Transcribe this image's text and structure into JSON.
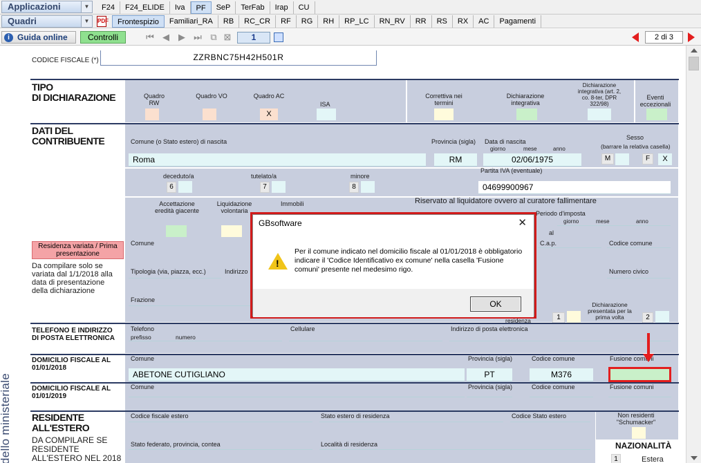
{
  "toolbar": {
    "applicazioni": "Applicazioni",
    "quadri": "Quadri",
    "tabs_top": [
      "F24",
      "F24_ELIDE",
      "Iva",
      "PF",
      "SeP",
      "TerFab",
      "Irap",
      "CU"
    ],
    "active_top": "PF",
    "tabs_second": [
      "Frontespizio",
      "Familiari_RA",
      "RB",
      "RC_CR",
      "RF",
      "RG",
      "RH",
      "RP_LC",
      "RN_RV",
      "RR",
      "RS",
      "RX",
      "AC",
      "Pagamenti"
    ],
    "active_second": "Frontespizio",
    "guida_online": "Guida online",
    "controlli": "Controlli",
    "page_number": "1",
    "page_count": "2 di 3"
  },
  "form": {
    "codice_fiscale_label": "CODICE FISCALE (*)",
    "codice_fiscale_value": "ZZRBNC75H42H501R",
    "tipo_title_1": "TIPO",
    "tipo_title_2": "DI DICHIARAZIONE",
    "quadro_rw": "Quadro RW",
    "quadro_vo": "Quadro VO",
    "quadro_ac": "Quadro AC",
    "quadro_ac_value": "X",
    "isa": "ISA",
    "correttiva": "Correttiva nei termini",
    "dich_integrativa": "Dichiarazione integrativa",
    "dich_integrativa_art": "Dichiarazione integrativa (art. 2, co. 8-ter, DPR 322/98)",
    "eventi": "Eventi eccezionali",
    "dati_title_1": "DATI DEL",
    "dati_title_2": "CONTRIBUENTE",
    "comune_nascita_label": "Comune (o Stato estero) di nascita",
    "comune_nascita_value": "Roma",
    "provincia_label": "Provincia (sigla)",
    "provincia_value": "RM",
    "data_nascita_label": "Data di nascita",
    "giorno": "giorno",
    "mese": "mese",
    "anno": "anno",
    "data_nascita_value": "02/06/1975",
    "sesso_label": "Sesso",
    "sesso_sub": "(barrare la relativa casella)",
    "sesso_m": "M",
    "sesso_f": "F",
    "sesso_value": "X",
    "deceduto": "deceduto/a",
    "deceduto_n": "6",
    "tutelato": "tutelato/a",
    "tutelato_n": "7",
    "minore": "minore",
    "minore_n": "8",
    "partita_iva_label": "Partita IVA (eventuale)",
    "partita_iva_value": "04699900967",
    "accettazione": "Accettazione eredità giacente",
    "liquidazione": "Liquidazione volontaria",
    "immobili": "Immobili",
    "riservato": "Riservato al liquidatore ovvero al curatore fallimentare",
    "periodo_imposta": "Periodo d'imposta",
    "al": "al",
    "residenza_variata": "Residenza variata / Prima presentazione",
    "da_compilare": "Da compilare solo se variata dal 1/1/2018 alla data di presentazione della dichiarazione",
    "comune": "Comune",
    "cap": "C.a.p.",
    "codice_comune": "Codice comune",
    "tipologia": "Tipologia (via, piazza, ecc.)",
    "indirizzo": "Indirizzo",
    "numero_civico": "Numero civico",
    "frazione": "Frazione",
    "residenza": "residenza",
    "dich_presentata": "Dichiarazione presentata per la prima volta",
    "dich_presentata_n": "2",
    "box_1": "1",
    "telefono_title": "TELEFONO E INDIRIZZO DI POSTA ELETTRONICA",
    "telefono": "Telefono",
    "prefisso": "prefisso",
    "numero": "numero",
    "cellulare": "Cellulare",
    "email": "Indirizzo di posta elettronica",
    "dom2018_title": "DOMICILIO FISCALE AL 01/01/2018",
    "dom2018_comune": "ABETONE CUTIGLIANO",
    "dom2018_prov": "PT",
    "dom2018_cod": "M376",
    "provincia_sigla": "Provincia (sigla)",
    "fusione_comuni": "Fusione comuni",
    "dom2019_title": "DOMICILIO FISCALE AL 01/01/2019",
    "residente_title_1": "RESIDENTE",
    "residente_title_2": "ALL'ESTERO",
    "residente_sub": "DA COMPILARE SE RESIDENTE ALL'ESTERO NEL 2018",
    "codice_fiscale_estero": "Codice fiscale estero",
    "stato_estero": "Stato estero di residenza",
    "codice_stato_estero": "Codice Stato estero",
    "non_residenti": "Non residenti \"Schumacker\"",
    "stato_federato": "Stato federato, provincia, contea",
    "localita": "Località di residenza",
    "nazionalita": "NAZIONALITÀ",
    "estera": "Estera",
    "estera_n": "1",
    "vertical_text": "dello ministeriale"
  },
  "dialog": {
    "title": "GBsoftware",
    "message": "Per il comune indicato nel domicilio fiscale al 01/01/2018 è obbligatorio indicare il 'Codice Identificativo ex comune' nella casella 'Fusione comuni' presente nel medesimo rigo.",
    "ok": "OK",
    "close": "✕"
  }
}
